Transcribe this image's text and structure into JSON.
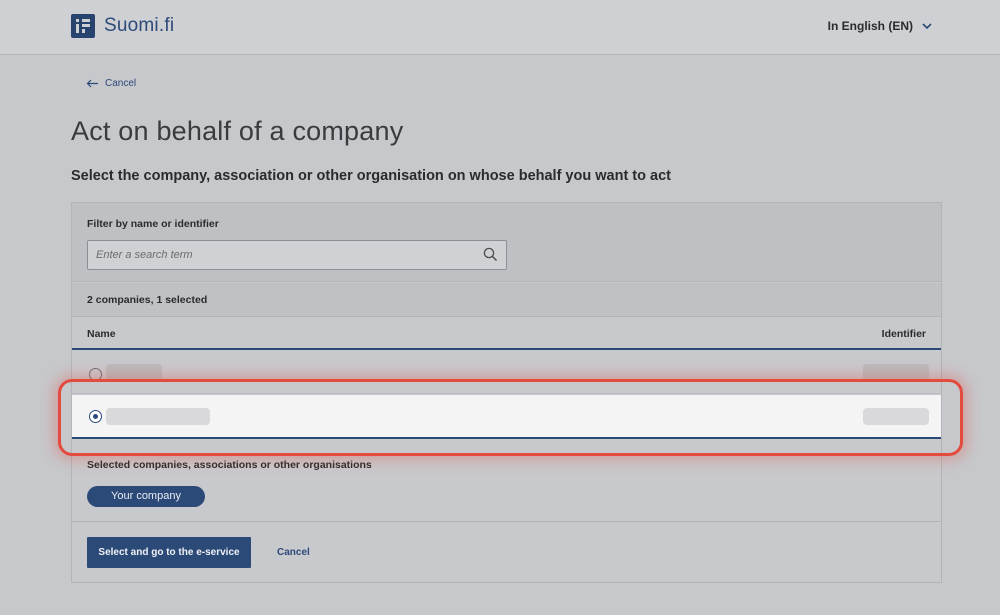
{
  "header": {
    "logo_text": "Suomi.fi",
    "language": "In English (EN)"
  },
  "nav": {
    "back_label": "Cancel"
  },
  "page": {
    "title": "Act on behalf of a company",
    "subtitle": "Select the company, association or other organisation on whose behalf you want to act"
  },
  "filter": {
    "label": "Filter by name or identifier",
    "placeholder": "Enter a search term"
  },
  "list": {
    "count_text": "2 companies, 1 selected",
    "columns": [
      "Name",
      "Identifier"
    ],
    "rows": [
      {
        "selected": false
      },
      {
        "selected": true
      }
    ]
  },
  "selection": {
    "label": "Selected companies, associations or other organisations",
    "chips": [
      "Your company"
    ]
  },
  "actions": {
    "primary_label": "Select and go to the e-service",
    "cancel_label": "Cancel"
  },
  "colors": {
    "brand": "#2c4a78",
    "highlight": "#e24b3e"
  }
}
